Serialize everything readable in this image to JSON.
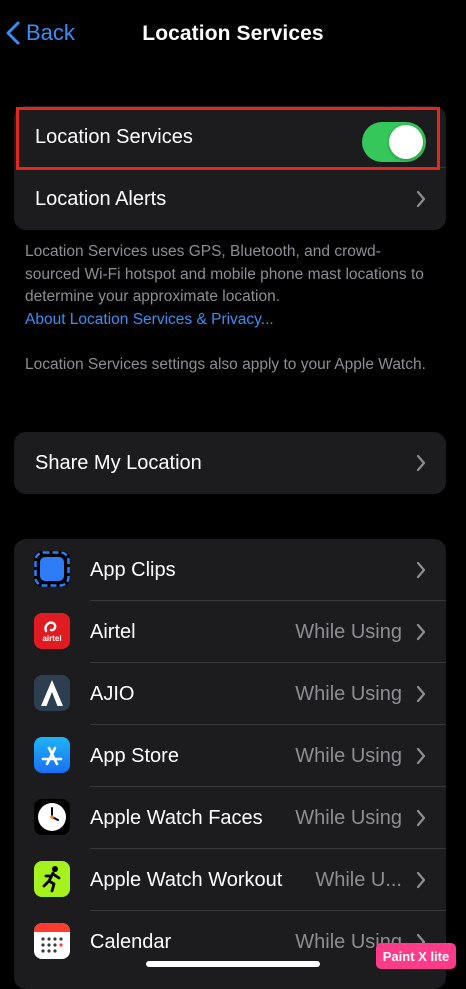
{
  "nav": {
    "back_label": "Back",
    "title": "Location Services"
  },
  "settings_group": {
    "location_services_label": "Location Services",
    "location_services_on": true,
    "location_alerts_label": "Location Alerts"
  },
  "footnote": {
    "description": "Location Services uses GPS, Bluetooth, and crowd-sourced Wi-Fi hotspot and mobile phone mast locations to determine your approximate location.",
    "link": "About Location Services & Privacy...",
    "watch_note": "Location Services settings also apply to your Apple Watch."
  },
  "share_group": {
    "share_label": "Share My Location"
  },
  "apps": [
    {
      "name": "App Clips",
      "value": "",
      "icon": "app-clips-icon"
    },
    {
      "name": "Airtel",
      "value": "While Using",
      "icon": "airtel-icon"
    },
    {
      "name": "AJIO",
      "value": "While Using",
      "icon": "ajio-icon"
    },
    {
      "name": "App Store",
      "value": "While Using",
      "icon": "app-store-icon"
    },
    {
      "name": "Apple Watch Faces",
      "value": "While Using",
      "icon": "apple-watch-faces-icon"
    },
    {
      "name": "Apple Watch Workout",
      "value": "While U...",
      "icon": "apple-watch-workout-icon"
    },
    {
      "name": "Calendar",
      "value": "While Using",
      "icon": "calendar-icon"
    }
  ],
  "icon_texts": {
    "airtel": "airtel"
  },
  "watermark": "Paint X lite",
  "colors": {
    "accent": "#3a8ef6",
    "toggle_on": "#34c759",
    "highlight": "#e5261f",
    "row_bg": "#1c1c1e"
  }
}
